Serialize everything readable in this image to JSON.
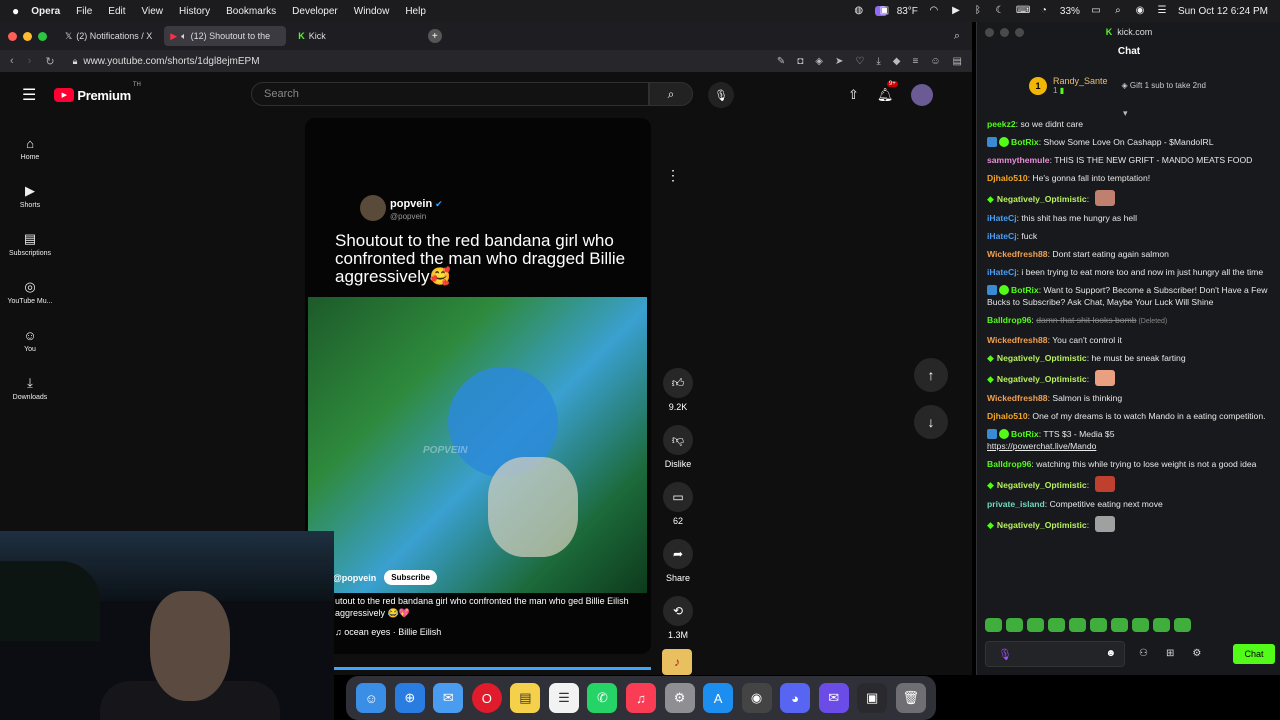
{
  "menubar": {
    "app": "Opera",
    "items": [
      "File",
      "Edit",
      "View",
      "History",
      "Bookmarks",
      "Developer",
      "Window",
      "Help"
    ],
    "temperature": "83°F",
    "battery": "33%",
    "datetime": "Sun Oct 12  6:24 PM"
  },
  "tabs": [
    {
      "label": "(2) Notifications / X"
    },
    {
      "label": "(12) Shoutout to the"
    },
    {
      "label": "Kick"
    }
  ],
  "url": "www.youtube.com/shorts/1dgl8ejmEPM",
  "youtube": {
    "logo": "Premium",
    "logo_sup": "TH",
    "search_placeholder": "Search",
    "notif_count": "9+",
    "sidebar": [
      {
        "label": "Home"
      },
      {
        "label": "Shorts"
      },
      {
        "label": "Subscriptions"
      },
      {
        "label": "YouTube Mu..."
      },
      {
        "label": "You"
      },
      {
        "label": "Downloads"
      }
    ],
    "short": {
      "channel": "popvein",
      "handle": "@popvein",
      "headline": "Shoutout to the red bandana girl who confronted the man who dragged Billie aggressively🥰",
      "watermark": "POPVEIN",
      "chan_row": "@popvein",
      "subscribe": "Subscribe",
      "caption": "utout to the red bandana girl who confronted the man who ged Billie Eilish aggressively 😂💖",
      "music": "ocean eyes · Billie Eilish"
    },
    "actions": {
      "likes": "9.2K",
      "dislike": "Dislike",
      "comments": "62",
      "share": "Share",
      "remix": "1.3M"
    }
  },
  "kick": {
    "site": "kick.com",
    "title": "Chat",
    "pinned": {
      "rank": "1",
      "name": "Randy_Sante",
      "count": "1",
      "gift": "Gift 1 sub to take 2nd"
    },
    "messages": [
      {
        "user": "peekz2",
        "text": "so we didnt care",
        "color": "#53fc18",
        "badge": "none"
      },
      {
        "user": "BotRix",
        "text": "Show Some Love On Cashapp - $MandoIRL",
        "color": "#53fc18",
        "badge": "bot"
      },
      {
        "user": "sammythemule",
        "text": "THIS IS THE NEW GRIFT - MANDO MEATS FOOD",
        "color": "#e88fd8",
        "badge": "none"
      },
      {
        "user": "Djhalo510",
        "text": "He's gonna fall into temptation!",
        "color": "#f5a623",
        "badge": "none"
      },
      {
        "user": "Negatively_Optimistic",
        "text": "",
        "color": "#b8f060",
        "badge": "diamond",
        "emote": "#c08070"
      },
      {
        "user": "iHateCj",
        "text": "this shit has me hungry as hell",
        "color": "#4a9ef5",
        "badge": "none"
      },
      {
        "user": "iHateCj",
        "text": "fuck",
        "color": "#4a9ef5",
        "badge": "none"
      },
      {
        "user": "Wickedfresh88",
        "text": "Dont start eating again salmon",
        "color": "#f0a050",
        "badge": "none"
      },
      {
        "user": "iHateCj",
        "text": "i been trying to eat more too and now im just hungry all the time",
        "color": "#4a9ef5",
        "badge": "none"
      },
      {
        "user": "BotRix",
        "text": "Want to Support? Become a Subscriber! Don't Have a Few Bucks to Subscribe? Ask Chat, Maybe Your Luck Will Shine",
        "color": "#53fc18",
        "badge": "bot"
      },
      {
        "user": "Balldrop96",
        "text": "damn that shit looks bomb",
        "color": "#53fc18",
        "badge": "none",
        "deleted": "(Deleted)"
      },
      {
        "user": "Wickedfresh88",
        "text": "You can't control it",
        "color": "#f0a050",
        "badge": "none"
      },
      {
        "user": "Negatively_Optimistic",
        "text": "he must be sneak farting",
        "color": "#b8f060",
        "badge": "diamond"
      },
      {
        "user": "Negatively_Optimistic",
        "text": "",
        "color": "#b8f060",
        "badge": "diamond",
        "emote": "#e8a080"
      },
      {
        "user": "Wickedfresh88",
        "text": "Salmon is thinking",
        "color": "#f0a050",
        "badge": "none"
      },
      {
        "user": "Djhalo510",
        "text": "One of my dreams is to watch Mando in a eating competition.",
        "color": "#f5a623",
        "badge": "none"
      },
      {
        "user": "BotRix",
        "text": "TTS $3 - Media $5",
        "color": "#53fc18",
        "badge": "bot",
        "link": "https://powerchat.live/Mando"
      },
      {
        "user": "Balldrop96",
        "text": "watching this while trying to lose weight is not a good idea",
        "color": "#53fc18",
        "badge": "none"
      },
      {
        "user": "Negatively_Optimistic",
        "text": "",
        "color": "#b8f060",
        "badge": "diamond",
        "emote": "#c04030"
      },
      {
        "user": "private_island",
        "text": "Competitive eating next move",
        "color": "#6fd8c0",
        "badge": "none"
      },
      {
        "user": "Negatively_Optimistic",
        "text": "",
        "color": "#b8f060",
        "badge": "diamond",
        "emote": "#a0a0a0"
      }
    ],
    "send_label": "Chat"
  }
}
